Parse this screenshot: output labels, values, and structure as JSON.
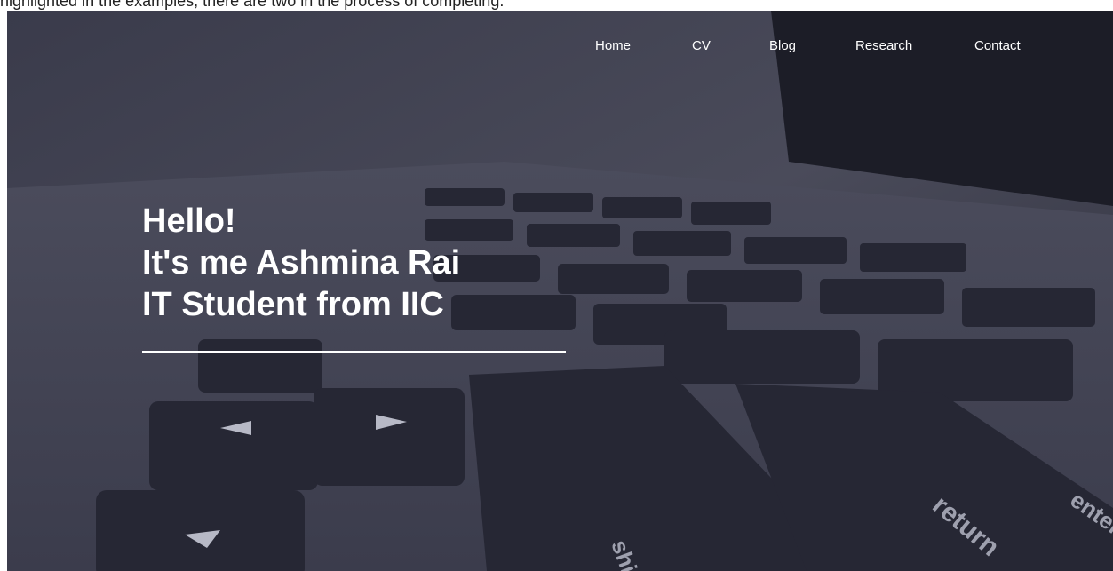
{
  "top_strip": {
    "clipped_text": "highlighted in the examples, there are two in the process of completing:"
  },
  "nav": {
    "items": [
      {
        "label": "Home"
      },
      {
        "label": "CV"
      },
      {
        "label": "Blog"
      },
      {
        "label": "Research"
      },
      {
        "label": "Contact"
      }
    ]
  },
  "hero": {
    "line1": "Hello!",
    "line2": "It's me Ashmina Rai",
    "line3": "IT Student from IIC",
    "keys": [
      "shift",
      "return",
      "enter"
    ],
    "colors": {
      "overlay": "#2f3040",
      "text": "#ffffff"
    }
  }
}
